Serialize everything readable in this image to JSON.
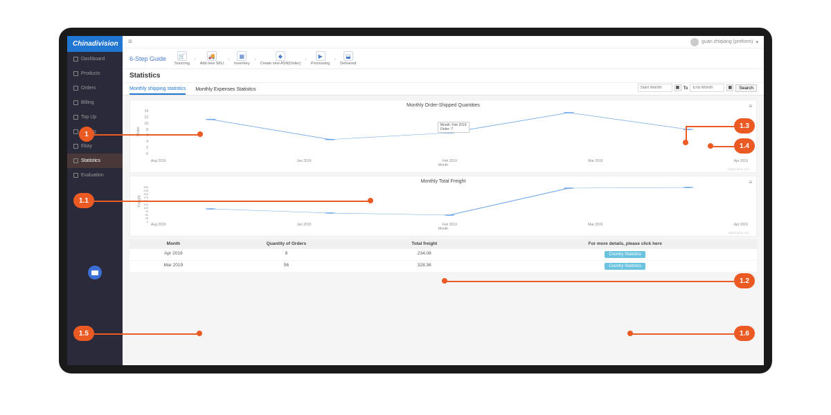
{
  "brand": "Chinadivision",
  "user": {
    "name": "guan zhiqiang (preform)"
  },
  "guide": {
    "title": "6-Step Guide",
    "steps": [
      "Sourcing",
      "Add new SKU",
      "Inventory",
      "Create new ASN(Order)",
      "Processing",
      "Delivered"
    ]
  },
  "sidebar": {
    "items": [
      {
        "label": "Dashboard"
      },
      {
        "label": "Products"
      },
      {
        "label": "Orders"
      },
      {
        "label": "Billing"
      },
      {
        "label": "Top Up"
      },
      {
        "label": "Setting"
      },
      {
        "label": "Ebay"
      },
      {
        "label": "Statistics",
        "active": true
      },
      {
        "label": "Evaluation"
      }
    ]
  },
  "page": {
    "title": "Statistics"
  },
  "tabs": [
    {
      "label": "Monthly shipping statistics",
      "active": true
    },
    {
      "label": "Monthly Expenses Statistics",
      "active": false
    }
  ],
  "search": {
    "start_placeholder": "Start Month",
    "to": "To",
    "end_placeholder": "End Month",
    "button": "Search"
  },
  "chart_data": [
    {
      "type": "line",
      "title": "Monthly Order-Shipped Quantities",
      "ylabel": "Order",
      "xlabel": "Month",
      "ylim": [
        0,
        14
      ],
      "yticks": [
        0,
        2,
        4,
        6,
        8,
        10,
        12,
        14
      ],
      "categories": [
        "Aug 2019",
        "Jan 2019",
        "Feb 2019",
        "Mar 2019",
        "Apr 2019"
      ],
      "values": [
        11,
        5,
        7,
        13,
        8
      ],
      "tooltip": {
        "category": "Feb 2019",
        "label": "Month: Feb 2019",
        "value_label": "Order: 7"
      }
    },
    {
      "type": "line",
      "title": "Monthly Total Freight",
      "ylabel": "Freight",
      "xlabel": "Month",
      "ylim": [
        0,
        250
      ],
      "yticks": [
        0,
        25,
        50,
        75,
        100,
        125,
        150,
        175,
        200,
        225,
        250
      ],
      "categories": [
        "Aug 2019",
        "Jan 2019",
        "Feb 2019",
        "Mar 2019",
        "Apr 2019"
      ],
      "values": [
        80,
        50,
        35,
        230,
        235
      ]
    }
  ],
  "table": {
    "headers": [
      "Month",
      "Quantity of Orders",
      "Total freight",
      "For more details, please click here"
    ],
    "rows": [
      {
        "month": "Apr 2019",
        "qty": "8",
        "freight": "234.08",
        "action": "Country Statistics"
      },
      {
        "month": "Mar 2019",
        "qty": "56",
        "freight": "328.36",
        "action": "Country Statistics"
      }
    ]
  },
  "callouts": {
    "c1": "1",
    "c11": "1.1",
    "c12": "1.2",
    "c13": "1.3",
    "c14": "1.4",
    "c15": "1.5",
    "c16": "1.6"
  }
}
